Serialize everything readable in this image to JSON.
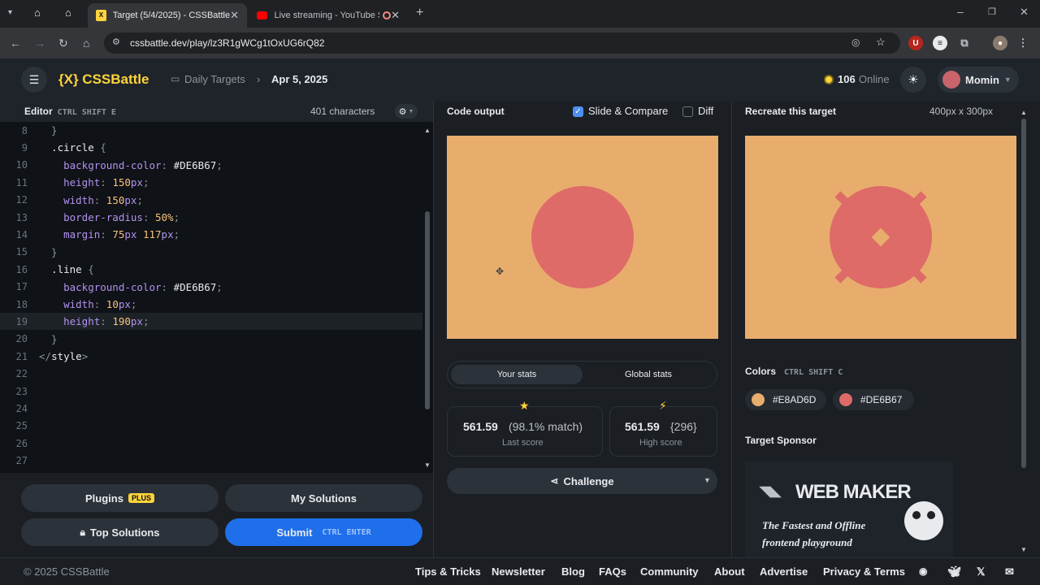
{
  "browser": {
    "tabs": [
      {
        "title": "Target (5/4/2025) - CSSBattle",
        "icon": "cssbattle-favicon-icon"
      },
      {
        "title": "Live streaming - YouTube S",
        "icon": "youtube-icon"
      }
    ],
    "url": "cssbattle.dev/play/lz3R1gWCg1tOxUG6rQ82"
  },
  "header": {
    "logo": "{X} CSSBattle",
    "breadcrumb_root": "Daily Targets",
    "breadcrumb_current": "Apr 5, 2025",
    "online_count": "106",
    "online_label": "Online",
    "user_name": "Momin"
  },
  "editor": {
    "title": "Editor",
    "shortcut": "CTRL SHIFT E",
    "char_count": "401 characters",
    "lines": [
      {
        "n": "8",
        "parts": [
          [
            "br",
            "  }"
          ]
        ]
      },
      {
        "n": "9",
        "parts": [
          [
            "sel",
            "  .circle "
          ],
          [
            "br",
            "{"
          ]
        ]
      },
      {
        "n": "10",
        "parts": [
          [
            "prop",
            "    background-color"
          ],
          [
            "br",
            ": "
          ],
          [
            "hex",
            "#DE6B67"
          ],
          [
            "br",
            ";"
          ]
        ]
      },
      {
        "n": "11",
        "parts": [
          [
            "prop",
            "    height"
          ],
          [
            "br",
            ": "
          ],
          [
            "val",
            "150"
          ],
          [
            "prop",
            "px"
          ],
          [
            "br",
            ";"
          ]
        ]
      },
      {
        "n": "12",
        "parts": [
          [
            "prop",
            "    width"
          ],
          [
            "br",
            ": "
          ],
          [
            "val",
            "150"
          ],
          [
            "prop",
            "px"
          ],
          [
            "br",
            ";"
          ]
        ]
      },
      {
        "n": "13",
        "parts": [
          [
            "prop",
            "    border-radius"
          ],
          [
            "br",
            ": "
          ],
          [
            "val",
            "50%"
          ],
          [
            "br",
            ";"
          ]
        ]
      },
      {
        "n": "14",
        "parts": [
          [
            "prop",
            "    margin"
          ],
          [
            "br",
            ": "
          ],
          [
            "val",
            "75"
          ],
          [
            "prop",
            "px "
          ],
          [
            "val",
            "117"
          ],
          [
            "prop",
            "px"
          ],
          [
            "br",
            ";"
          ]
        ]
      },
      {
        "n": "15",
        "parts": [
          [
            "br",
            "  }"
          ]
        ]
      },
      {
        "n": "16",
        "parts": [
          [
            "sel",
            "  .line "
          ],
          [
            "br",
            "{"
          ]
        ]
      },
      {
        "n": "17",
        "parts": [
          [
            "prop",
            "    background-color"
          ],
          [
            "br",
            ": "
          ],
          [
            "hex",
            "#DE6B67"
          ],
          [
            "br",
            ";"
          ]
        ]
      },
      {
        "n": "18",
        "parts": [
          [
            "prop",
            "    width"
          ],
          [
            "br",
            ": "
          ],
          [
            "val",
            "10"
          ],
          [
            "prop",
            "px"
          ],
          [
            "br",
            ";"
          ]
        ]
      },
      {
        "n": "19",
        "parts": [
          [
            "prop",
            "    height"
          ],
          [
            "br",
            ": "
          ],
          [
            "val",
            "190"
          ],
          [
            "prop",
            "px"
          ],
          [
            "br",
            ";"
          ]
        ],
        "current": true
      },
      {
        "n": "20",
        "parts": [
          [
            "br",
            "  }"
          ]
        ]
      },
      {
        "n": "21",
        "parts": [
          [
            "br",
            "</"
          ],
          [
            "tag",
            "style"
          ],
          [
            "br",
            ">"
          ]
        ]
      },
      {
        "n": "22",
        "parts": []
      },
      {
        "n": "23",
        "parts": []
      },
      {
        "n": "24",
        "parts": []
      },
      {
        "n": "25",
        "parts": []
      },
      {
        "n": "26",
        "parts": []
      },
      {
        "n": "27",
        "parts": []
      }
    ]
  },
  "buttons": {
    "plugins": "Plugins",
    "plugins_badge": "PLUS",
    "my_solutions": "My Solutions",
    "top_solutions": "Top Solutions",
    "submit": "Submit",
    "submit_shortcut": "CTRL ENTER",
    "challenge": "Challenge"
  },
  "output": {
    "title": "Code output",
    "slide_compare": "Slide & Compare",
    "slide_compare_checked": true,
    "diff": "Diff",
    "diff_checked": false
  },
  "stats": {
    "tab_yours": "Your stats",
    "tab_global": "Global stats",
    "last_score": "561.59",
    "last_match": "(98.1% match)",
    "last_label": "Last score",
    "high_score": "561.59",
    "high_chars": "{296}",
    "high_label": "High score"
  },
  "target": {
    "title": "Recreate this target",
    "size": "400px x 300px",
    "colors_title": "Colors",
    "colors_shortcut": "CTRL SHIFT C",
    "colors": [
      "#E8AD6D",
      "#DE6B67"
    ],
    "sponsor_title": "Target Sponsor",
    "sponsor_name": "WEB MAKER",
    "sponsor_tagline_1": "The Fastest and Offline",
    "sponsor_tagline_2": "frontend playground"
  },
  "footer": {
    "copyright": "© 2025 CSSBattle",
    "links": [
      "Tips & Tricks",
      "Newsletter",
      "Blog",
      "FAQs",
      "Community",
      "About",
      "Advertise",
      "Privacy & Terms"
    ]
  }
}
